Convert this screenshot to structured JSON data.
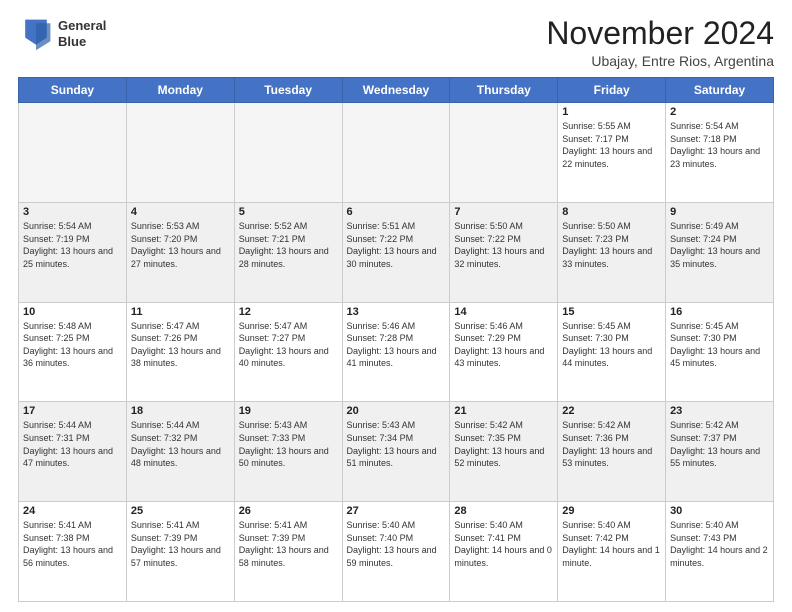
{
  "header": {
    "logo_line1": "General",
    "logo_line2": "Blue",
    "month": "November 2024",
    "location": "Ubajay, Entre Rios, Argentina"
  },
  "days_of_week": [
    "Sunday",
    "Monday",
    "Tuesday",
    "Wednesday",
    "Thursday",
    "Friday",
    "Saturday"
  ],
  "weeks": [
    [
      {
        "day": "",
        "info": ""
      },
      {
        "day": "",
        "info": ""
      },
      {
        "day": "",
        "info": ""
      },
      {
        "day": "",
        "info": ""
      },
      {
        "day": "",
        "info": ""
      },
      {
        "day": "1",
        "info": "Sunrise: 5:55 AM\nSunset: 7:17 PM\nDaylight: 13 hours\nand 22 minutes."
      },
      {
        "day": "2",
        "info": "Sunrise: 5:54 AM\nSunset: 7:18 PM\nDaylight: 13 hours\nand 23 minutes."
      }
    ],
    [
      {
        "day": "3",
        "info": "Sunrise: 5:54 AM\nSunset: 7:19 PM\nDaylight: 13 hours\nand 25 minutes."
      },
      {
        "day": "4",
        "info": "Sunrise: 5:53 AM\nSunset: 7:20 PM\nDaylight: 13 hours\nand 27 minutes."
      },
      {
        "day": "5",
        "info": "Sunrise: 5:52 AM\nSunset: 7:21 PM\nDaylight: 13 hours\nand 28 minutes."
      },
      {
        "day": "6",
        "info": "Sunrise: 5:51 AM\nSunset: 7:22 PM\nDaylight: 13 hours\nand 30 minutes."
      },
      {
        "day": "7",
        "info": "Sunrise: 5:50 AM\nSunset: 7:22 PM\nDaylight: 13 hours\nand 32 minutes."
      },
      {
        "day": "8",
        "info": "Sunrise: 5:50 AM\nSunset: 7:23 PM\nDaylight: 13 hours\nand 33 minutes."
      },
      {
        "day": "9",
        "info": "Sunrise: 5:49 AM\nSunset: 7:24 PM\nDaylight: 13 hours\nand 35 minutes."
      }
    ],
    [
      {
        "day": "10",
        "info": "Sunrise: 5:48 AM\nSunset: 7:25 PM\nDaylight: 13 hours\nand 36 minutes."
      },
      {
        "day": "11",
        "info": "Sunrise: 5:47 AM\nSunset: 7:26 PM\nDaylight: 13 hours\nand 38 minutes."
      },
      {
        "day": "12",
        "info": "Sunrise: 5:47 AM\nSunset: 7:27 PM\nDaylight: 13 hours\nand 40 minutes."
      },
      {
        "day": "13",
        "info": "Sunrise: 5:46 AM\nSunset: 7:28 PM\nDaylight: 13 hours\nand 41 minutes."
      },
      {
        "day": "14",
        "info": "Sunrise: 5:46 AM\nSunset: 7:29 PM\nDaylight: 13 hours\nand 43 minutes."
      },
      {
        "day": "15",
        "info": "Sunrise: 5:45 AM\nSunset: 7:30 PM\nDaylight: 13 hours\nand 44 minutes."
      },
      {
        "day": "16",
        "info": "Sunrise: 5:45 AM\nSunset: 7:30 PM\nDaylight: 13 hours\nand 45 minutes."
      }
    ],
    [
      {
        "day": "17",
        "info": "Sunrise: 5:44 AM\nSunset: 7:31 PM\nDaylight: 13 hours\nand 47 minutes."
      },
      {
        "day": "18",
        "info": "Sunrise: 5:44 AM\nSunset: 7:32 PM\nDaylight: 13 hours\nand 48 minutes."
      },
      {
        "day": "19",
        "info": "Sunrise: 5:43 AM\nSunset: 7:33 PM\nDaylight: 13 hours\nand 50 minutes."
      },
      {
        "day": "20",
        "info": "Sunrise: 5:43 AM\nSunset: 7:34 PM\nDaylight: 13 hours\nand 51 minutes."
      },
      {
        "day": "21",
        "info": "Sunrise: 5:42 AM\nSunset: 7:35 PM\nDaylight: 13 hours\nand 52 minutes."
      },
      {
        "day": "22",
        "info": "Sunrise: 5:42 AM\nSunset: 7:36 PM\nDaylight: 13 hours\nand 53 minutes."
      },
      {
        "day": "23",
        "info": "Sunrise: 5:42 AM\nSunset: 7:37 PM\nDaylight: 13 hours\nand 55 minutes."
      }
    ],
    [
      {
        "day": "24",
        "info": "Sunrise: 5:41 AM\nSunset: 7:38 PM\nDaylight: 13 hours\nand 56 minutes."
      },
      {
        "day": "25",
        "info": "Sunrise: 5:41 AM\nSunset: 7:39 PM\nDaylight: 13 hours\nand 57 minutes."
      },
      {
        "day": "26",
        "info": "Sunrise: 5:41 AM\nSunset: 7:39 PM\nDaylight: 13 hours\nand 58 minutes."
      },
      {
        "day": "27",
        "info": "Sunrise: 5:40 AM\nSunset: 7:40 PM\nDaylight: 13 hours\nand 59 minutes."
      },
      {
        "day": "28",
        "info": "Sunrise: 5:40 AM\nSunset: 7:41 PM\nDaylight: 14 hours\nand 0 minutes."
      },
      {
        "day": "29",
        "info": "Sunrise: 5:40 AM\nSunset: 7:42 PM\nDaylight: 14 hours\nand 1 minute."
      },
      {
        "day": "30",
        "info": "Sunrise: 5:40 AM\nSunset: 7:43 PM\nDaylight: 14 hours\nand 2 minutes."
      }
    ]
  ]
}
